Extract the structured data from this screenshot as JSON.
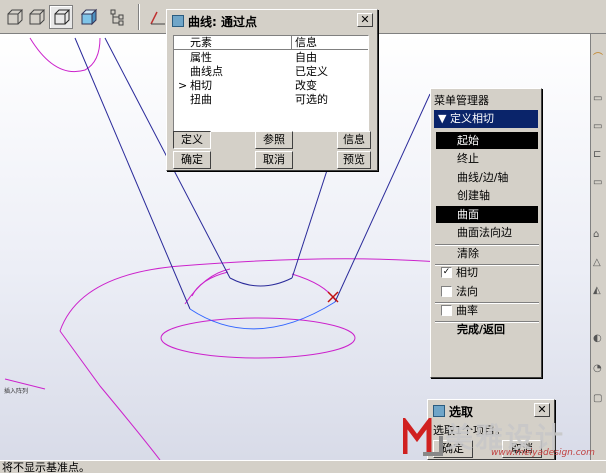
{
  "toolbar": {
    "icons": [
      "cube-shaded-icon",
      "cube-wire-icon",
      "cube-hidden-icon",
      "cube-solid-icon",
      "tree-icon",
      "datum-curve-icon"
    ]
  },
  "viewport": {
    "small_tag": "插入阵列"
  },
  "curve_dialog": {
    "title": "曲线: 通过点",
    "headers": {
      "element": "元素",
      "info": "信息"
    },
    "rows": [
      {
        "element": "属性",
        "info": "自由",
        "marker": ""
      },
      {
        "element": "曲线点",
        "info": "已定义",
        "marker": ""
      },
      {
        "element": "相切",
        "info": "改变",
        "marker": ">"
      },
      {
        "element": "扭曲",
        "info": "可选的",
        "marker": ""
      }
    ],
    "buttons": {
      "define": "定义",
      "reference": "参照",
      "info": "信息",
      "ok": "确定",
      "cancel": "取消",
      "preview": "预览"
    }
  },
  "menu_manager": {
    "title": "菜单管理器",
    "header": "定义相切",
    "items": [
      {
        "label": "起始",
        "selected": true
      },
      {
        "label": "终止",
        "selected": false
      },
      {
        "label": "曲线/边/轴",
        "selected": false
      },
      {
        "label": "创建轴",
        "selected": false
      },
      {
        "label": "曲面",
        "selected": true
      },
      {
        "label": "曲面法向边",
        "selected": false
      }
    ],
    "clear": "清除",
    "checks": [
      {
        "label": "相切",
        "checked": true
      },
      {
        "label": "法向",
        "checked": false
      },
      {
        "label": "曲率",
        "checked": false
      }
    ],
    "done": "完成/返回"
  },
  "select_dialog": {
    "title": "选取",
    "message": "选取1个项目。",
    "ok": "确定",
    "cancel": "取消"
  },
  "status_bar": {
    "text": "将不显示基准点。"
  },
  "watermark": {
    "logo_text": "美雅设计",
    "url": "www.meiyadesign.com"
  },
  "colors": {
    "curve_purple": "#cc22cc",
    "curve_blue": "#3366ff",
    "edge_navy": "#2a2a9a",
    "selection": "#000000",
    "menu_header": "#0a246a"
  }
}
